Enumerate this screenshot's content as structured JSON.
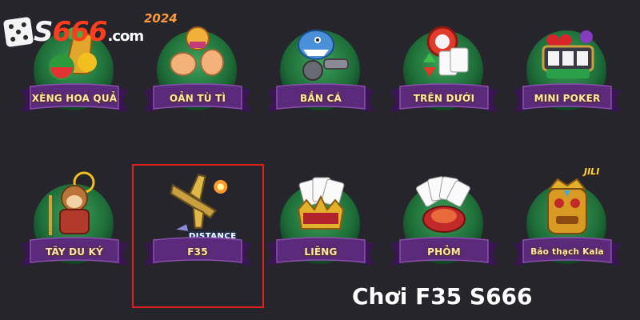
{
  "logo": {
    "s": "S",
    "num": "666",
    "com": ".com",
    "year": "2024"
  },
  "games": [
    {
      "label": "XÈNG HOA QUẢ",
      "icon": "fruit-machine-icon"
    },
    {
      "label": "OẢN TÙ TÌ",
      "icon": "rock-paper-scissors-icon"
    },
    {
      "label": "BẮN CÁ",
      "icon": "shark-gun-icon"
    },
    {
      "label": "TRÊN DƯỚI",
      "icon": "cards-chip-icon"
    },
    {
      "label": "MINI POKER",
      "icon": "slot-wild-icon"
    },
    {
      "label": "TÂY DU KÝ",
      "icon": "monkey-king-icon"
    },
    {
      "label": "F35",
      "icon": "fighter-jet-icon",
      "sub": "DISTANCE"
    },
    {
      "label": "LIÊNG",
      "icon": "cards-crown-icon"
    },
    {
      "label": "PHỎM",
      "icon": "card-fan-icon"
    },
    {
      "label": "Bảo thạch Kala",
      "icon": "golden-mask-icon",
      "sub": "JILI"
    }
  ],
  "caption": "Chơi F35 S666",
  "colors": {
    "background": "#25252b",
    "ribbon": "#5b2a7a",
    "ribbon_text": "#ffe9a8",
    "highlight": "#e01f1f",
    "accent": "#ff3c1e"
  }
}
